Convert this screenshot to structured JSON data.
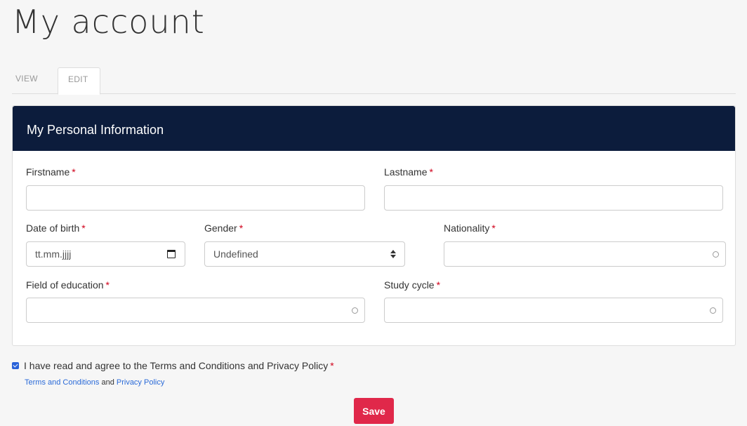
{
  "page": {
    "title": "My account"
  },
  "tabs": [
    {
      "label": "VIEW"
    },
    {
      "label": "EDIT"
    }
  ],
  "panel": {
    "title": "My Personal Information"
  },
  "required_marker": "*",
  "fields": {
    "firstname": {
      "label": "Firstname",
      "value": ""
    },
    "lastname": {
      "label": "Lastname",
      "value": ""
    },
    "date_of_birth": {
      "label": "Date of birth",
      "placeholder": "tt.mm.jjjj"
    },
    "gender": {
      "label": "Gender",
      "selected": "Undefined"
    },
    "nationality": {
      "label": "Nationality",
      "value": ""
    },
    "field_of_education": {
      "label": "Field of education",
      "value": ""
    },
    "study_cycle": {
      "label": "Study cycle",
      "value": ""
    }
  },
  "agreement": {
    "checked": true,
    "label": "I have read and agree to the Terms and Conditions and Privacy Policy",
    "terms_link": "Terms and Conditions",
    "and_text": "and",
    "privacy_link": "Privacy Policy"
  },
  "actions": {
    "save_label": "Save"
  },
  "colors": {
    "header_bg": "#0c1c3c",
    "save_bg": "#e0284a",
    "required": "#d0021b",
    "link": "#2a6ad8"
  }
}
